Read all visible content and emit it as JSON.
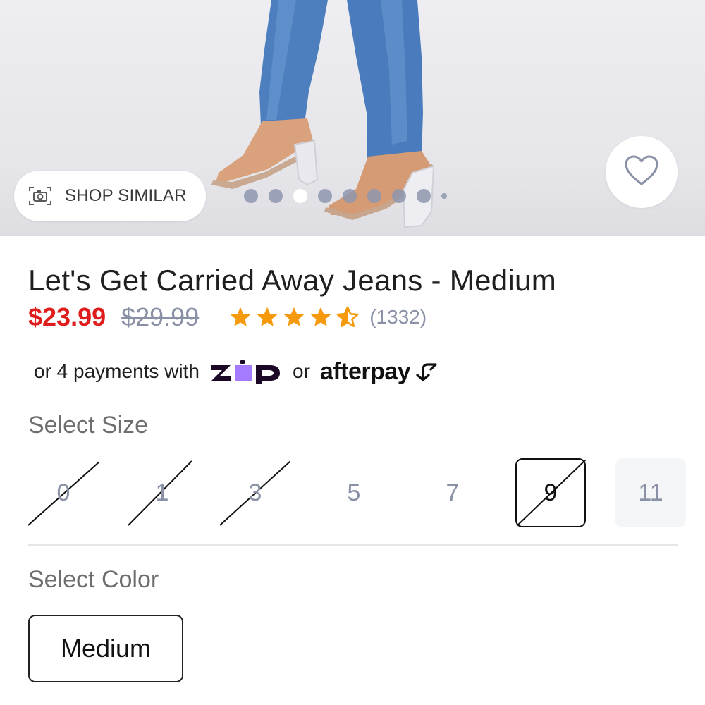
{
  "hero": {
    "shop_similar_label": "SHOP SIMILAR",
    "carousel_total_dots": 9,
    "carousel_active_index": 3
  },
  "product": {
    "title": "Let's Get Carried Away Jeans - Medium",
    "sale_price": "$23.99",
    "original_price": "$29.99",
    "rating": 4.5,
    "review_count": "(1332)"
  },
  "payments": {
    "prefix": "or 4 payments with",
    "zip_logo": "ZIP",
    "middle": "or",
    "afterpay_logo": "afterpay"
  },
  "size_section": {
    "label": "Select Size",
    "options": [
      {
        "label": "0",
        "available": false
      },
      {
        "label": "1",
        "available": false
      },
      {
        "label": "3",
        "available": false
      },
      {
        "label": "5",
        "available": true
      },
      {
        "label": "7",
        "available": true
      },
      {
        "label": "9",
        "available": false,
        "selected": true
      },
      {
        "label": "11",
        "available": true
      }
    ]
  },
  "color_section": {
    "label": "Select Color",
    "options": [
      {
        "label": "Medium",
        "selected": true
      }
    ]
  },
  "colors": {
    "sale_red": "#e01d1d",
    "muted_gray_blue": "#8a91a6",
    "star_orange": "#f59a0c",
    "zip_purple": "#a47aff",
    "zip_navy": "#1a0826"
  },
  "icons": {
    "shop_similar": "camera-frame-icon",
    "favorite": "heart-outline-icon",
    "rating": "star-icon",
    "afterpay_mark": "afterpay-arrows-icon"
  }
}
